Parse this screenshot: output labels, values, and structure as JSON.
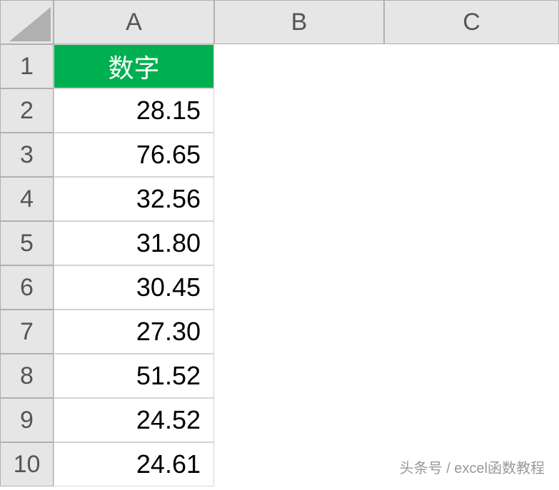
{
  "columns": [
    "A",
    "B",
    "C"
  ],
  "rows": [
    "1",
    "2",
    "3",
    "4",
    "5",
    "6",
    "7",
    "8",
    "9",
    "10"
  ],
  "header": {
    "a1": "数字"
  },
  "data": {
    "a2": "28.15",
    "a3": "76.65",
    "a4": "32.56",
    "a5": "31.80",
    "a6": "30.45",
    "a7": "27.30",
    "a8": "51.52",
    "a9": "24.52",
    "a10": "24.61"
  },
  "watermark": "头条号 / excel函数教程",
  "chart_data": {
    "type": "table",
    "title": "数字",
    "columns": [
      "数字"
    ],
    "rows": [
      [
        28.15
      ],
      [
        76.65
      ],
      [
        32.56
      ],
      [
        31.8
      ],
      [
        30.45
      ],
      [
        27.3
      ],
      [
        51.52
      ],
      [
        24.52
      ],
      [
        24.61
      ]
    ]
  }
}
